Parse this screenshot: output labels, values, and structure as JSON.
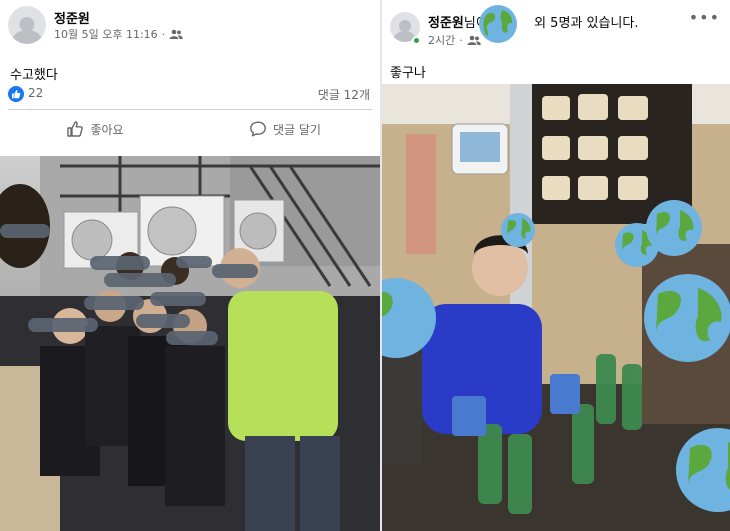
{
  "left_post": {
    "author": "정준원",
    "timestamp": "10월 5일 오후 11:16",
    "audience_icon": "friends-icon",
    "text": "수고했다",
    "reaction_count": "22",
    "comment_count": "댓글 12개",
    "like_label": "좋아요",
    "comment_label": "댓글 달기"
  },
  "right_post": {
    "author": "정준원",
    "author_suffix": "님이",
    "with_text": "외 5명과 있습니다.",
    "timestamp": "2시간",
    "audience_icon": "friends-icon",
    "text": "좋구나",
    "menu_icon": "more-options-icon"
  },
  "colors": {
    "like_blue": "#1877f2",
    "online_green": "#31a24c",
    "secondary_text": "#65676b"
  }
}
